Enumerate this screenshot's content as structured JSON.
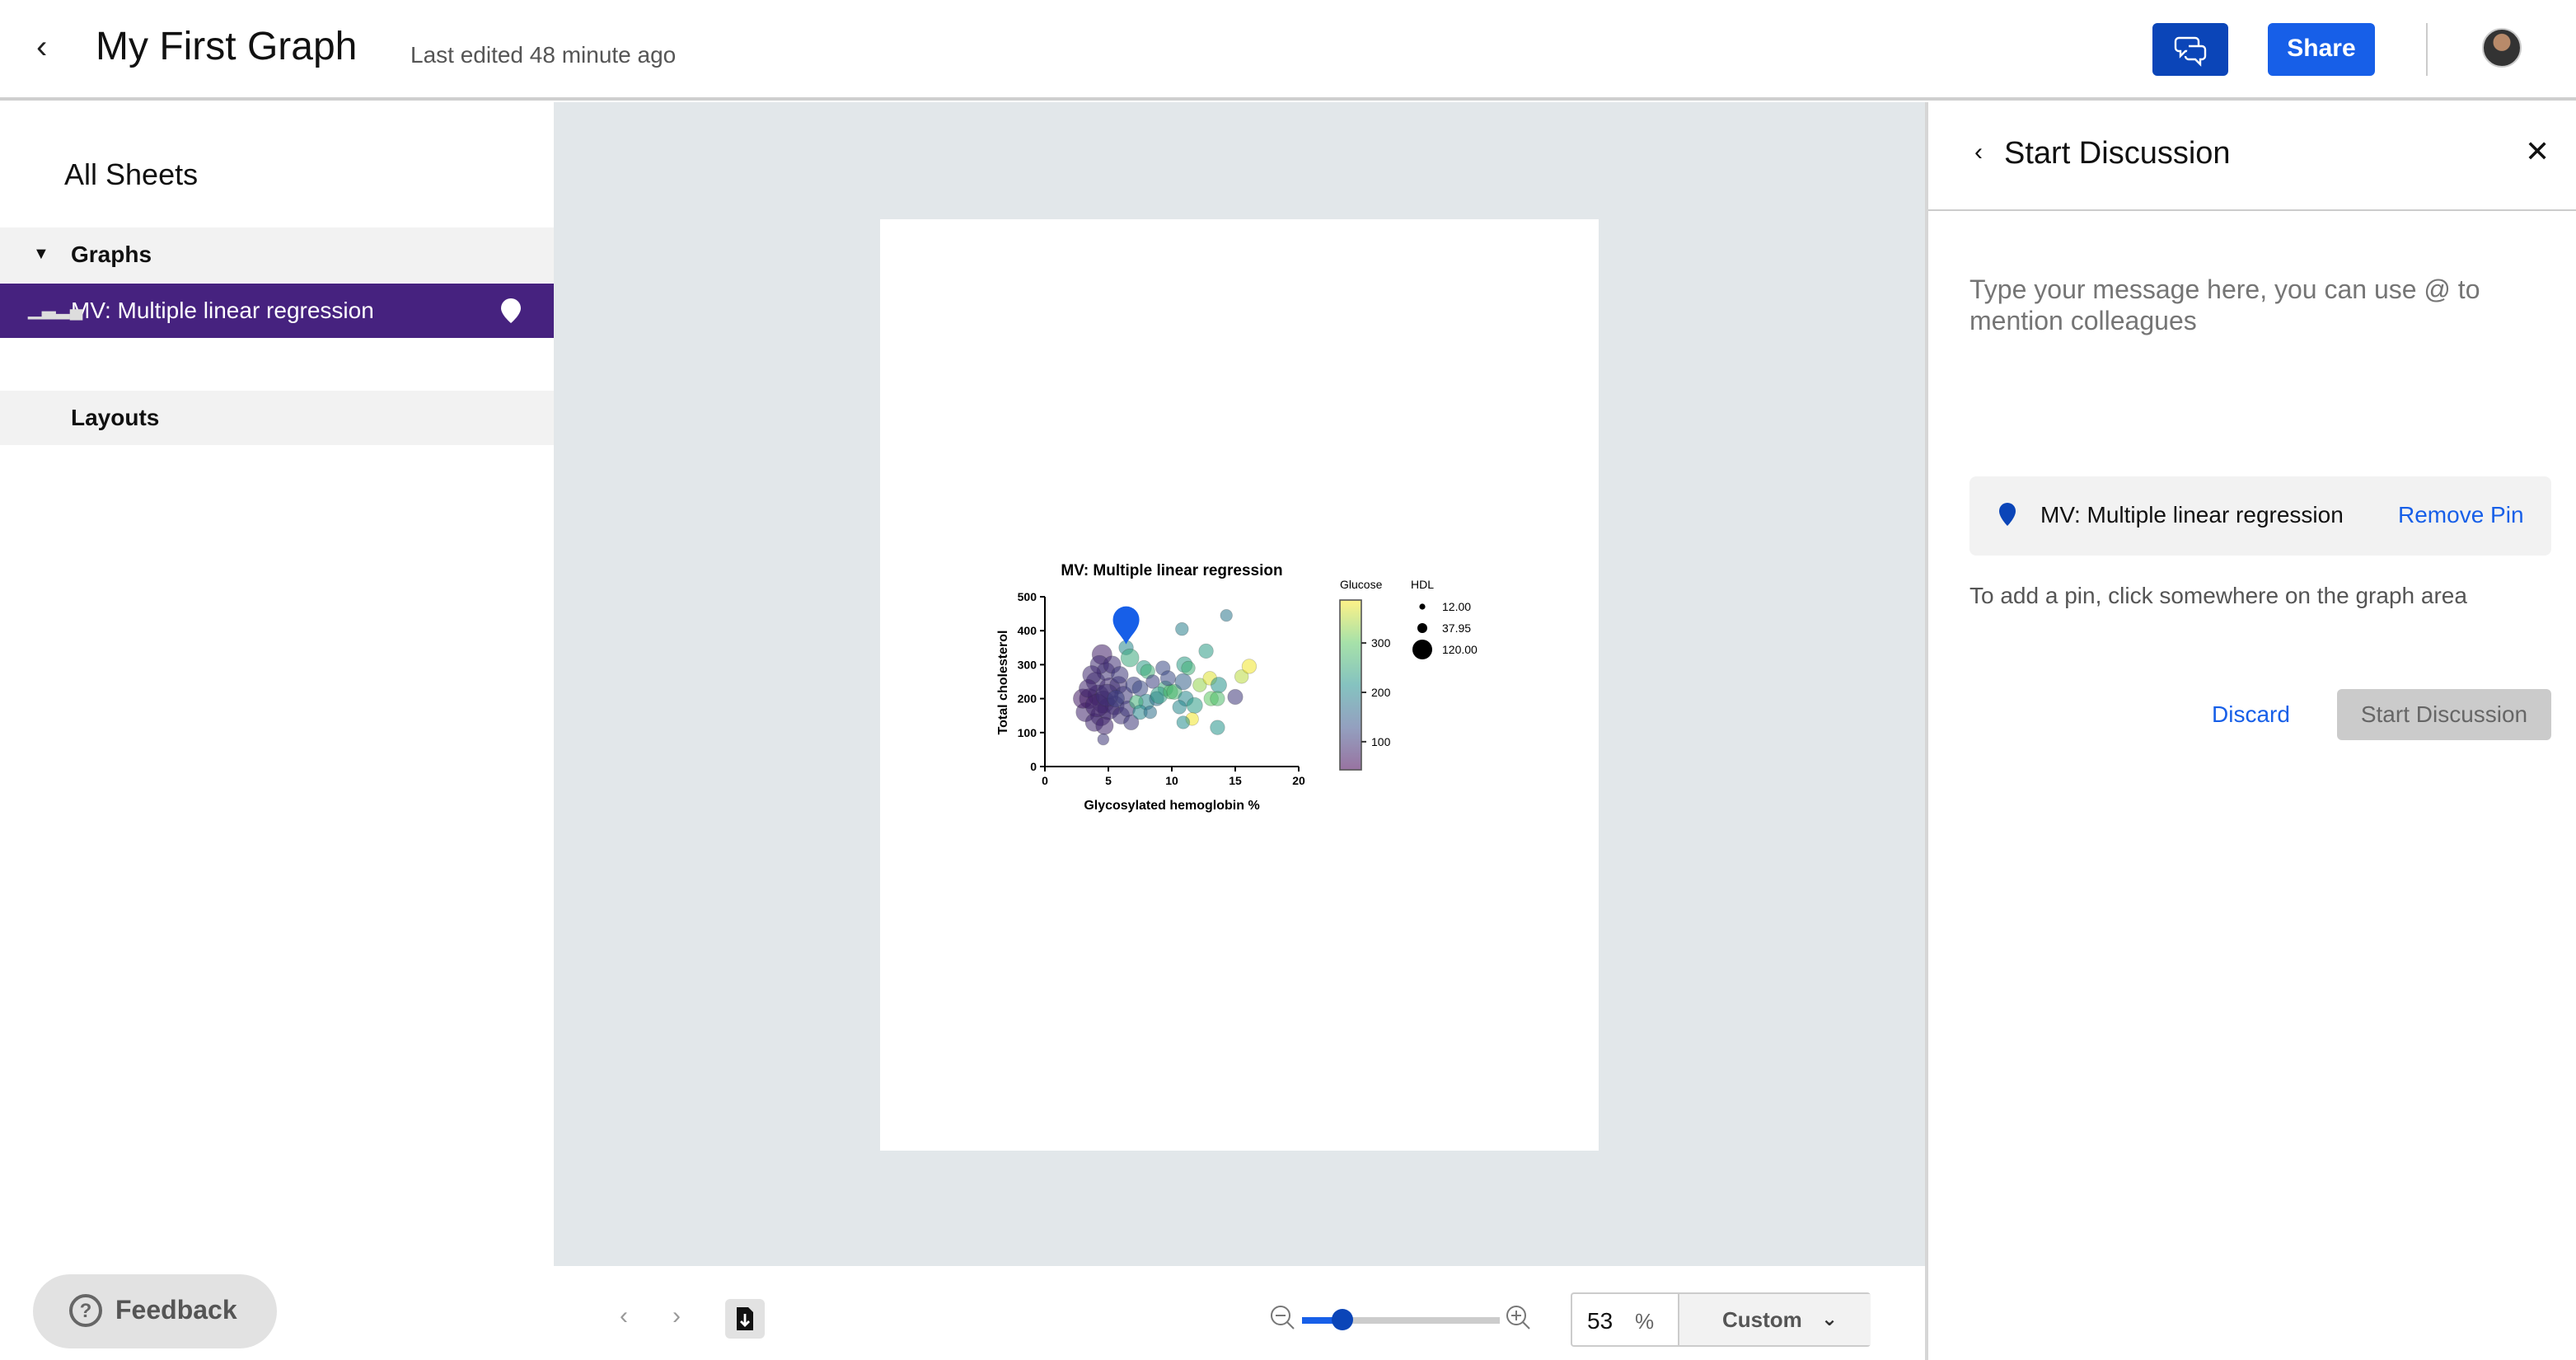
{
  "header": {
    "title": "My First Graph",
    "last_edited": "Last edited 48 minute ago",
    "share_label": "Share",
    "comments_icon": "chat-bubbles-icon"
  },
  "sidebar": {
    "all_sheets": "All Sheets",
    "graphs_label": "Graphs",
    "selected_item": "MV: Multiple linear regression",
    "layouts_label": "Layouts",
    "feedback_label": "Feedback"
  },
  "toolbar": {
    "zoom_value": "53",
    "zoom_unit": "%",
    "zoom_mode": "Custom",
    "zoom_level_percent": 53
  },
  "panel": {
    "title": "Start Discussion",
    "placeholder": "Type your message here, you can use @ to mention colleagues",
    "pinned_item": "MV: Multiple linear regression",
    "remove_pin": "Remove Pin",
    "hint": "To add a pin, click somewhere on the graph area",
    "discard": "Discard",
    "start": "Start Discussion",
    "pin_color": "#0b45b8",
    "accent": "#175fe8"
  },
  "chart_data": {
    "type": "scatter",
    "title": "MV: Multiple linear regression",
    "xlabel": "Glycosylated hemoglobin %",
    "ylabel": "Total cholesterol",
    "xlim": [
      0,
      20
    ],
    "ylim": [
      0,
      500
    ],
    "xticks": [
      "0",
      "5",
      "10",
      "15",
      "20"
    ],
    "yticks": [
      "0",
      "100",
      "200",
      "300",
      "400",
      "500"
    ],
    "color_legend": {
      "title": "Glucose",
      "ticks": [
        "100",
        "200",
        "300"
      ],
      "range": [
        43,
        387
      ],
      "colormap": "viridis"
    },
    "size_legend": {
      "title": "HDL",
      "entries": [
        "12.00",
        "37.95",
        "120.00"
      ]
    },
    "pin": {
      "x": 6.4,
      "y": 360
    },
    "points": [
      [
        4.2,
        210,
        80,
        90
      ],
      [
        4.6,
        190,
        85,
        110
      ],
      [
        3.5,
        200,
        75,
        80
      ],
      [
        4.0,
        250,
        90,
        70
      ],
      [
        4.8,
        280,
        95,
        60
      ],
      [
        5.1,
        230,
        85,
        95
      ],
      [
        3.2,
        160,
        80,
        70
      ],
      [
        4.4,
        150,
        78,
        85
      ],
      [
        3.9,
        130,
        82,
        60
      ],
      [
        5.5,
        180,
        90,
        70
      ],
      [
        4.5,
        330,
        75,
        80
      ],
      [
        4.3,
        300,
        88,
        65
      ],
      [
        3.0,
        200,
        70,
        75
      ],
      [
        5.8,
        240,
        95,
        55
      ],
      [
        6.2,
        210,
        100,
        60
      ],
      [
        5.0,
        170,
        85,
        100
      ],
      [
        4.7,
        120,
        80,
        55
      ],
      [
        3.7,
        270,
        85,
        65
      ],
      [
        5.3,
        300,
        90,
        55
      ],
      [
        6.0,
        150,
        95,
        50
      ],
      [
        4.1,
        180,
        78,
        120
      ],
      [
        4.9,
        210,
        92,
        110
      ],
      [
        3.4,
        230,
        80,
        60
      ],
      [
        5.6,
        200,
        110,
        50
      ],
      [
        6.5,
        170,
        100,
        40
      ],
      [
        7.0,
        240,
        110,
        45
      ],
      [
        7.5,
        230,
        120,
        40
      ],
      [
        6.8,
        130,
        100,
        35
      ],
      [
        4.6,
        80,
        100,
        12
      ],
      [
        5.9,
        270,
        100,
        50
      ],
      [
        6.4,
        350,
        200,
        30
      ],
      [
        6.7,
        320,
        250,
        60
      ],
      [
        7.8,
        290,
        230,
        35
      ],
      [
        8.1,
        280,
        260,
        30
      ],
      [
        8.5,
        250,
        110,
        25
      ],
      [
        9.3,
        290,
        120,
        30
      ],
      [
        9.5,
        230,
        250,
        35
      ],
      [
        8.0,
        190,
        200,
        40
      ],
      [
        8.8,
        200,
        170,
        30
      ],
      [
        9.0,
        210,
        230,
        50
      ],
      [
        7.2,
        190,
        260,
        25
      ],
      [
        7.5,
        160,
        200,
        30
      ],
      [
        8.3,
        160,
        170,
        20
      ],
      [
        9.9,
        220,
        280,
        30
      ],
      [
        10.2,
        220,
        270,
        35
      ],
      [
        10.9,
        250,
        150,
        45
      ],
      [
        11.0,
        300,
        230,
        40
      ],
      [
        11.3,
        290,
        260,
        25
      ],
      [
        11.1,
        200,
        200,
        35
      ],
      [
        11.8,
        180,
        230,
        40
      ],
      [
        12.2,
        240,
        330,
        25
      ],
      [
        12.7,
        340,
        230,
        30
      ],
      [
        13.0,
        260,
        370,
        25
      ],
      [
        13.1,
        200,
        300,
        30
      ],
      [
        13.7,
        240,
        220,
        40
      ],
      [
        13.6,
        200,
        280,
        30
      ],
      [
        14.3,
        445,
        180,
        15
      ],
      [
        10.8,
        405,
        190,
        20
      ],
      [
        15.0,
        205,
        100,
        35
      ],
      [
        15.5,
        265,
        350,
        25
      ],
      [
        16.1,
        295,
        380,
        30
      ],
      [
        11.6,
        140,
        380,
        20
      ],
      [
        10.9,
        130,
        210,
        20
      ],
      [
        13.6,
        115,
        220,
        30
      ],
      [
        10.6,
        175,
        200,
        25
      ],
      [
        9.7,
        260,
        120,
        35
      ]
    ]
  }
}
